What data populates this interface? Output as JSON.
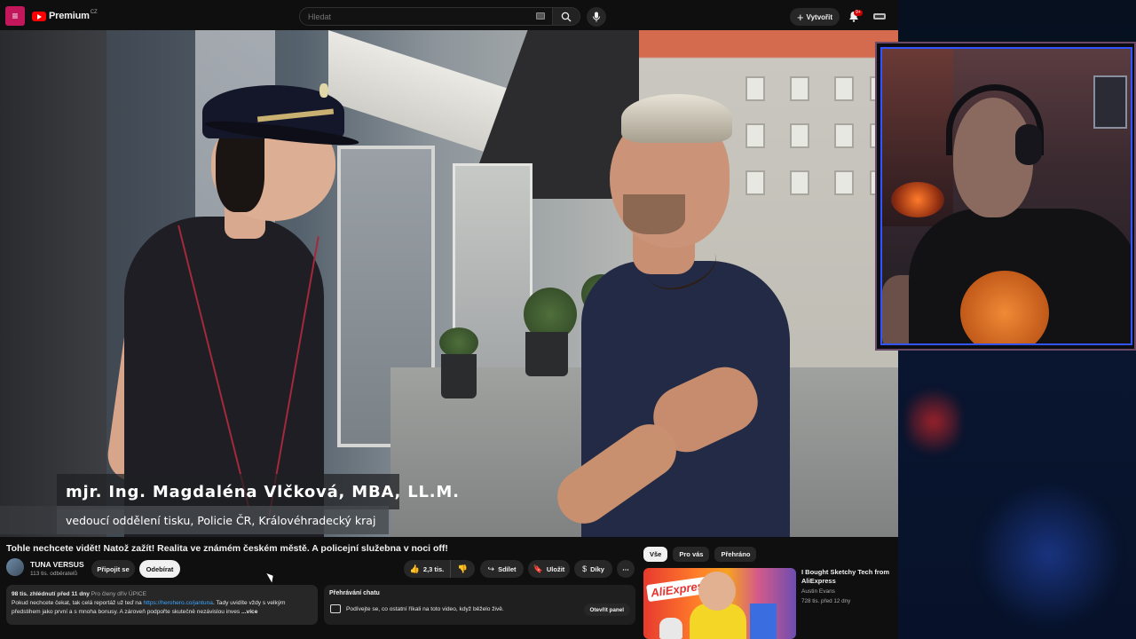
{
  "header": {
    "menu_icon": "hamburger-icon",
    "logo_text": "Premium",
    "logo_region": "CZ",
    "search_placeholder": "Hledat",
    "create_label": "Vytvořit",
    "notifications_badge": "9+",
    "accent": "#ff0000"
  },
  "video": {
    "lower_third": {
      "name": "mjr. Ing. Magdaléna Vlčková, MBA, LL.M.",
      "role": "vedoucí oddělení tisku, Policie ČR, Královéhradecký kraj"
    }
  },
  "info": {
    "title": "Tohle nechcete vidět! Natož zažít! Realita ve známém českém městě. A policejní služebna v noci off!",
    "channel_name": "TUNA VERSUS",
    "channel_subs": "113 tis. odběratelů",
    "join_label": "Připojit se",
    "subscribe_label": "Odebírat",
    "like_count": "2,3 tis.",
    "share_label": "Sdílet",
    "save_label": "Uložit",
    "thanks_label": "Díky",
    "more_label": "⋯"
  },
  "description": {
    "views_date": "98 tis. zhlédnutí  před 11 dny",
    "members": "Pro členy dřív  ÚPICE",
    "text_1": "Pokud nechcete čekat, tak celá reportáž už teď na ",
    "link": "https://herohero.co/jantuna",
    "text_2": ". Tady uvidíte vždy s velkým předstihem jako první a s mnoha bonusy. A zároveň podpořte skutečně nezávislou inves",
    "more": "...více"
  },
  "chat_replay": {
    "header": "Přehrávání chatu",
    "text": "Podívejte se, co ostatní říkali na toto video, když běželo živě.",
    "open_label": "Otevřít panel"
  },
  "sidebar": {
    "chips": [
      {
        "label": "Vše",
        "active": true
      },
      {
        "label": "Pro vás",
        "active": false
      },
      {
        "label": "Přehráno",
        "active": false
      }
    ],
    "recommendation": {
      "thumb_text": "AliExpress",
      "title": "I Bought Sketchy Tech from AliExpress",
      "channel": "Austin Evans",
      "meta": "728 tis.  před 12 dny"
    }
  }
}
